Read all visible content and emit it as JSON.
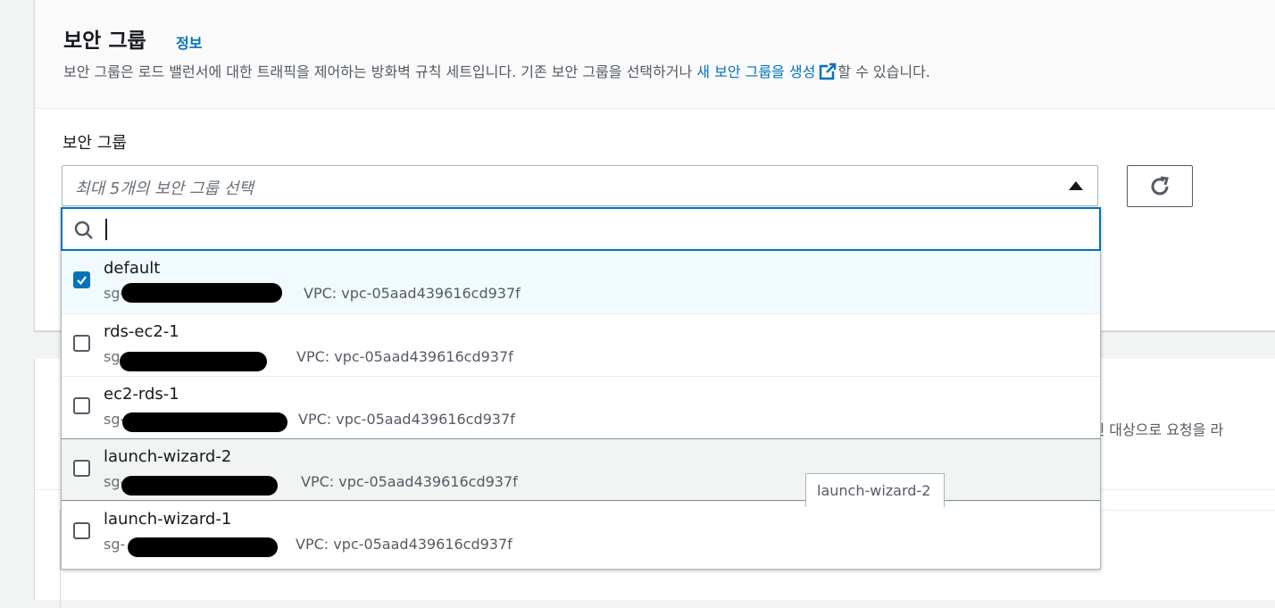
{
  "section": {
    "title": "보안 그룹",
    "info_link": "정보",
    "description_prefix": "보안 그룹은 로드 밸런서에 대한 트래픽을 제어하는 방화벽 규칙 세트입니다. 기존 보안 그룹을 선택하거나 ",
    "description_link": "새 보안 그룹을 생성",
    "description_suffix": "할 수 있습니다."
  },
  "field": {
    "label": "보안 그룹",
    "placeholder": "최대 5개의 보안 그룹 선택"
  },
  "search": {
    "value": ""
  },
  "options": [
    {
      "name": "default",
      "id_prefix": "sg-",
      "vpc": "VPC: vpc-05aad439616cd937f",
      "checked": true
    },
    {
      "name": "rds-ec2-1",
      "id_prefix": "sg-",
      "vpc": "VPC: vpc-05aad439616cd937f",
      "checked": false
    },
    {
      "name": "ec2-rds-1",
      "id_prefix": "sg-",
      "vpc": "VPC: vpc-05aad439616cd937f",
      "checked": false
    },
    {
      "name": "launch-wizard-2",
      "id_prefix": "sg-",
      "vpc": "VPC: vpc-05aad439616cd937f",
      "checked": false
    },
    {
      "name": "launch-wizard-1",
      "id_prefix": "sg-",
      "vpc": "VPC: vpc-05aad439616cd937f",
      "checked": false
    }
  ],
  "tooltip": {
    "text": "launch-wizard-2"
  },
  "background": {
    "partial_text": "등록된 대상으로 요청을 라"
  },
  "colors": {
    "accent": "#0073bb",
    "selected_bg": "#f1faff",
    "hover_bg": "#f2f3f3"
  }
}
